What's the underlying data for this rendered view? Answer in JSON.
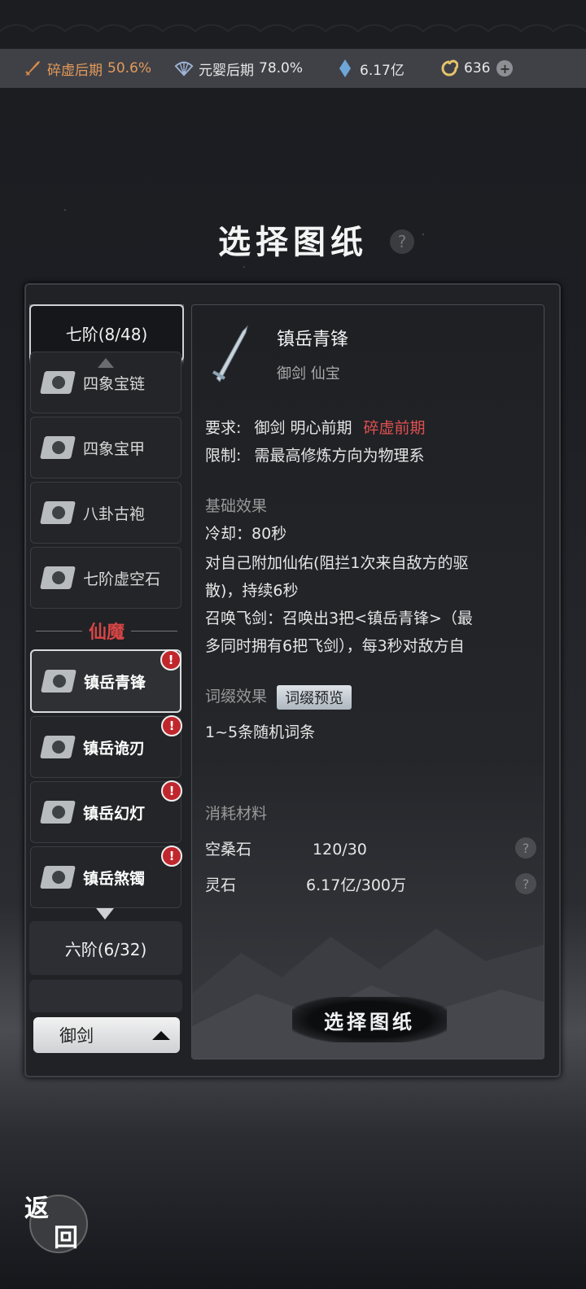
{
  "status": {
    "cultivation": {
      "label": "碎虚后期",
      "value": "50.6%",
      "color": "#e39a5a"
    },
    "secondary": {
      "label": "元婴后期",
      "value": "78.0%"
    },
    "spirit_stone": "6.17亿",
    "currency": "636",
    "add_symbol": "+"
  },
  "title": "选择图纸",
  "help_symbol": "?",
  "left": {
    "tier_top": "七阶(8/48)",
    "items_top": [
      "四象宝链",
      "四象宝甲",
      "八卦古袍",
      "七阶虚空石"
    ],
    "section_label": "仙魔",
    "items_section": [
      {
        "label": "镇岳青锋",
        "badge": "!"
      },
      {
        "label": "镇岳诡刃",
        "badge": "!"
      },
      {
        "label": "镇岳幻灯",
        "badge": "!"
      },
      {
        "label": "镇岳煞镯",
        "badge": "!"
      }
    ],
    "tier_next": "六阶(6/32)",
    "filter": "御剑"
  },
  "detail": {
    "name": "镇岳青锋",
    "tags": "御剑  仙宝",
    "req_label": "要求:",
    "req_normal": "御剑  明心前期",
    "req_red": "碎虚前期",
    "limit_label": "限制:",
    "limit_text": "需最高修炼方向为物理系",
    "base_header": "基础效果",
    "effects": [
      "冷却：80秒",
      "对自己附加仙佑(阻拦1次来自敌方的驱",
      "散)，持续6秒",
      "召唤飞剑：召唤出3把<镇岳青锋>（最",
      "多同时拥有6把飞剑），每3秒对敌方自"
    ],
    "affix_header": "词缀效果",
    "affix_preview": "词缀预览",
    "affix_text": "1~5条随机词条",
    "materials_header": "消耗材料",
    "materials": [
      {
        "name": "空桑石",
        "amount": "120/30"
      },
      {
        "name": "灵石",
        "amount": "6.17亿/300万"
      }
    ],
    "action": "选择图纸"
  },
  "back": {
    "c1": "返",
    "c2": "回"
  }
}
